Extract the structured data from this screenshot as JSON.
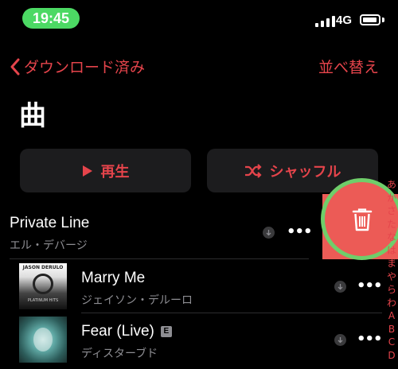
{
  "status_bar": {
    "time": "19:45",
    "network": "4G"
  },
  "nav": {
    "back_label": "ダウンロード済み",
    "sort_label": "並べ替え"
  },
  "page": {
    "title": "曲"
  },
  "actions": {
    "play_label": "再生",
    "shuffle_label": "シャッフル"
  },
  "songs": [
    {
      "title": "Private Line",
      "artist": "エル・デバージ",
      "explicit": false
    },
    {
      "title": "Marry Me",
      "artist": "ジェイソン・デルーロ",
      "explicit": false,
      "art_text_top": "JASON DERULO",
      "art_text_bottom": "PLATINUM HITS"
    },
    {
      "title": "Fear (Live)",
      "artist": "ディスターブド",
      "explicit": true,
      "explicit_label": "E"
    }
  ],
  "index_letters": [
    "あ",
    "か",
    "さ",
    "た",
    "な",
    "は",
    "ま",
    "や",
    "ら",
    "わ",
    "A",
    "B",
    "C",
    "D"
  ],
  "colors": {
    "accent": "#e5444b",
    "delete": "#ec5b56",
    "highlight_ring": "#6fce6a",
    "time_pill": "#4cd964"
  },
  "icons": [
    "chevron-left-icon",
    "play-icon",
    "shuffle-icon",
    "download-icon",
    "more-icon",
    "trash-icon",
    "signal-icon",
    "battery-icon"
  ]
}
